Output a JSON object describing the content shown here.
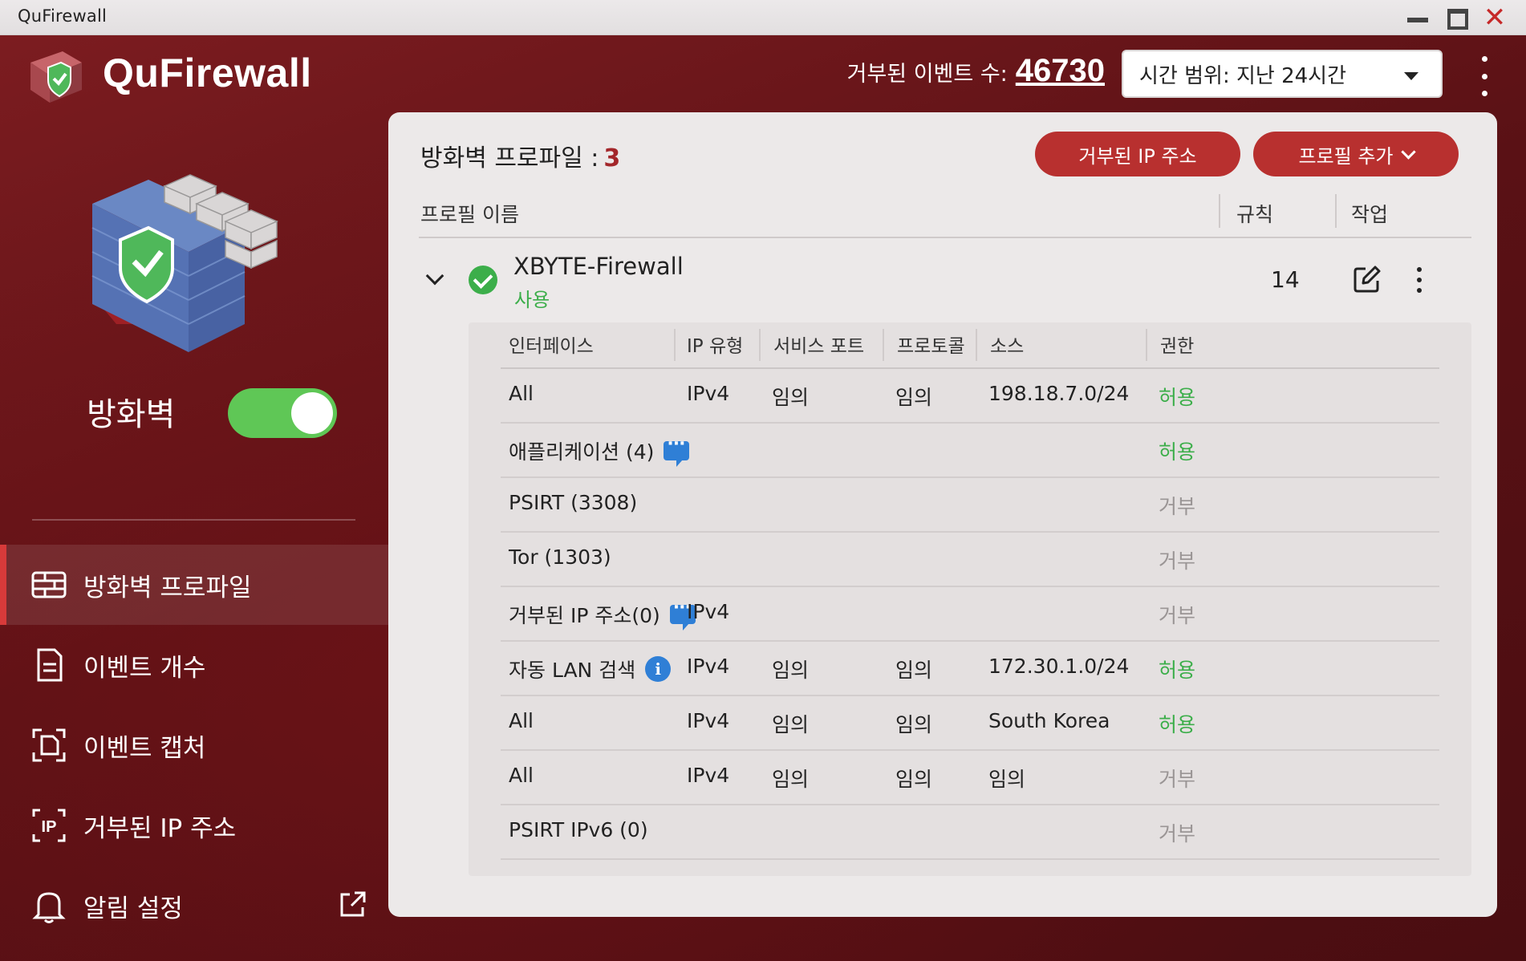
{
  "window": {
    "title": "QuFirewall"
  },
  "header": {
    "app_name": "QuFirewall",
    "denied_events_label": "거부된 이벤트 수:",
    "denied_events_count": "46730",
    "time_range": "시간 범위: 지난 24시간"
  },
  "sidebar": {
    "firewall_label": "방화벽",
    "firewall_enabled": true,
    "items": [
      {
        "label": "방화벽 프로파일",
        "icon": "firewall-profile-icon",
        "active": true
      },
      {
        "label": "이벤트 개수",
        "icon": "document-icon",
        "active": false
      },
      {
        "label": "이벤트 캡처",
        "icon": "capture-icon",
        "active": false
      },
      {
        "label": "거부된 IP 주소",
        "icon": "ip-icon",
        "active": false
      },
      {
        "label": "알림 설정",
        "icon": "bell-icon",
        "active": false
      }
    ]
  },
  "main": {
    "profiles_label": "방화벽 프로파일 :",
    "profiles_count": "3",
    "btn_denied_ip": "거부된 IP 주소",
    "btn_add_profile": "프로필 추가",
    "columns": {
      "name": "프로필 이름",
      "rules": "규칙",
      "action": "작업"
    },
    "profile": {
      "name": "XBYTE-Firewall",
      "status": "사용",
      "rules_count": "14"
    },
    "rule_columns": [
      "인터페이스",
      "IP 유형",
      "서비스 포트",
      "프로토콜",
      "소스",
      "권한"
    ],
    "rules": [
      {
        "interface": "All",
        "ip_type": "IPv4",
        "port": "임의",
        "protocol": "임의",
        "source": "198.18.7.0/24",
        "permission": "허용"
      },
      {
        "interface": "애플리케이션 (4)",
        "ip_type": "",
        "port": "",
        "protocol": "",
        "source": "",
        "permission": "허용"
      },
      {
        "interface": "PSIRT (3308)",
        "ip_type": "",
        "port": "",
        "protocol": "",
        "source": "",
        "permission": "거부"
      },
      {
        "interface": "Tor (1303)",
        "ip_type": "",
        "port": "",
        "protocol": "",
        "source": "",
        "permission": "거부"
      },
      {
        "interface": "거부된 IP 주소(0)",
        "ip_type": "IPv4",
        "port": "",
        "protocol": "",
        "source": "",
        "permission": "거부"
      },
      {
        "interface": "자동 LAN 검색",
        "ip_type": "IPv4",
        "port": "임의",
        "protocol": "임의",
        "source": "172.30.1.0/24",
        "permission": "허용"
      },
      {
        "interface": "All",
        "ip_type": "IPv4",
        "port": "임의",
        "protocol": "임의",
        "source": "South Korea",
        "permission": "허용"
      },
      {
        "interface": "All",
        "ip_type": "IPv4",
        "port": "임의",
        "protocol": "임의",
        "source": "임의",
        "permission": "거부"
      },
      {
        "interface": "PSIRT IPv6 (0)",
        "ip_type": "",
        "port": "",
        "protocol": "",
        "source": "",
        "permission": "거부"
      }
    ]
  },
  "colors": {
    "accent": "#b8302f",
    "allow": "#3cae4a",
    "deny": "#9a9595",
    "sidebar_bg": "#5a1115"
  }
}
